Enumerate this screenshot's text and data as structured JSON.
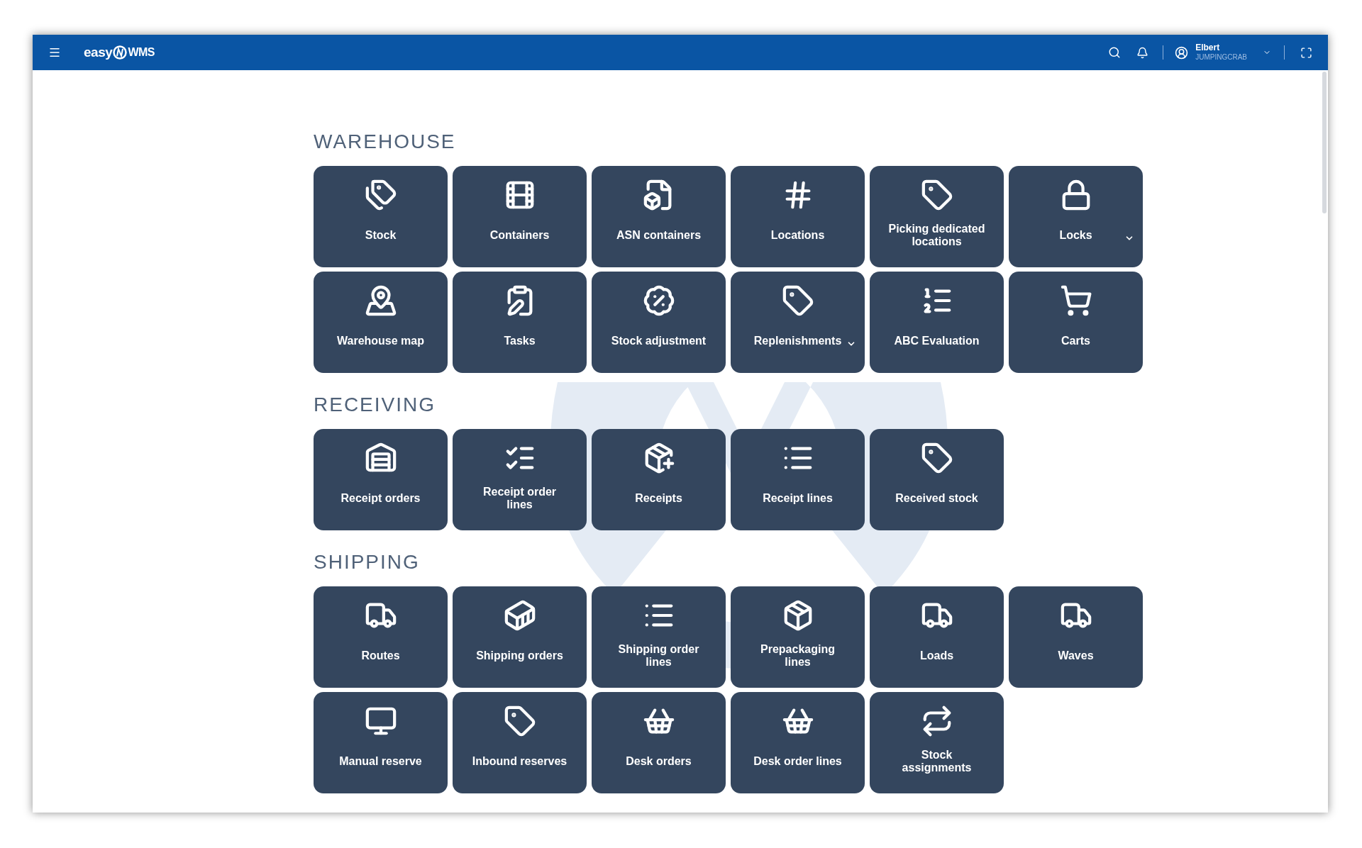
{
  "header": {
    "logo_left": "easy",
    "logo_right": "WMS",
    "user": {
      "name": "Elbert",
      "company": "JUMPINGCRAB"
    }
  },
  "sections": [
    {
      "title": "WAREHOUSE",
      "tiles": [
        {
          "label": "Stock",
          "has_submenu": false
        },
        {
          "label": "Containers",
          "has_submenu": false
        },
        {
          "label": "ASN containers",
          "has_submenu": false
        },
        {
          "label": "Locations",
          "has_submenu": false
        },
        {
          "label": "Picking dedicated locations",
          "has_submenu": false
        },
        {
          "label": "Locks",
          "has_submenu": true
        },
        {
          "label": "Warehouse map",
          "has_submenu": false
        },
        {
          "label": "Tasks",
          "has_submenu": false
        },
        {
          "label": "Stock adjustment",
          "has_submenu": false
        },
        {
          "label": "Replenishments",
          "has_submenu": true
        },
        {
          "label": "ABC Evaluation",
          "has_submenu": false
        },
        {
          "label": "Carts",
          "has_submenu": false
        }
      ]
    },
    {
      "title": "RECEIVING",
      "tiles": [
        {
          "label": "Receipt orders",
          "has_submenu": false
        },
        {
          "label": "Receipt order lines",
          "has_submenu": false
        },
        {
          "label": "Receipts",
          "has_submenu": false
        },
        {
          "label": "Receipt lines",
          "has_submenu": false
        },
        {
          "label": "Received stock",
          "has_submenu": false
        }
      ]
    },
    {
      "title": "SHIPPING",
      "tiles": [
        {
          "label": "Routes",
          "has_submenu": false
        },
        {
          "label": "Shipping orders",
          "has_submenu": false
        },
        {
          "label": "Shipping order lines",
          "has_submenu": false
        },
        {
          "label": "Prepackaging lines",
          "has_submenu": false
        },
        {
          "label": "Loads",
          "has_submenu": false
        },
        {
          "label": "Waves",
          "has_submenu": false
        },
        {
          "label": "Manual reserve",
          "has_submenu": false
        },
        {
          "label": "Inbound reserves",
          "has_submenu": false
        },
        {
          "label": "Desk orders",
          "has_submenu": false
        },
        {
          "label": "Desk order lines",
          "has_submenu": false
        },
        {
          "label": "Stock assignments",
          "has_submenu": false
        }
      ]
    }
  ]
}
